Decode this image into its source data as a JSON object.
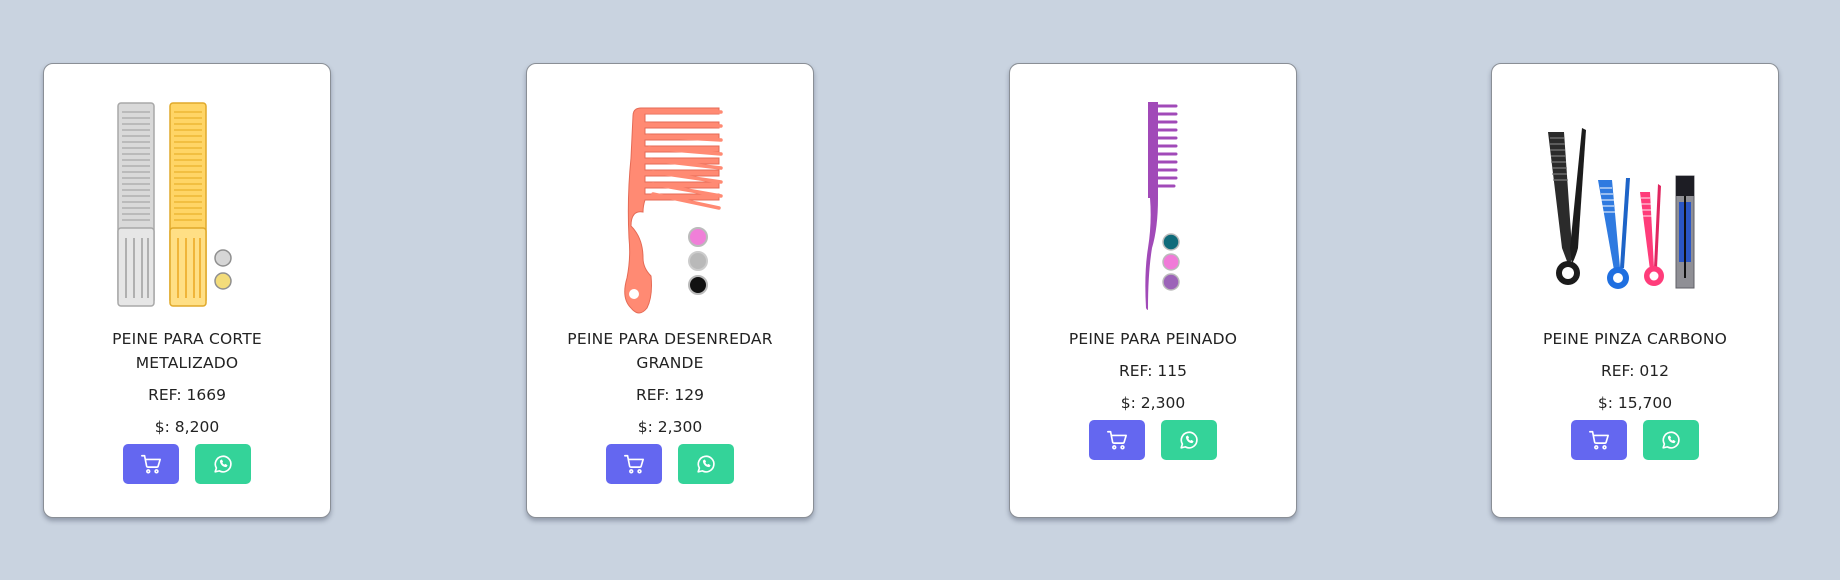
{
  "products": [
    {
      "name": "PEINE PARA CORTE METALIZADO",
      "ref": "REF: 1669",
      "price": "$: 8,200",
      "image": "comb-silver-gold"
    },
    {
      "name": "PEINE PARA DESENREDAR GRANDE",
      "ref": "REF: 129",
      "price": "$: 2,300",
      "image": "detangle-comb-coral"
    },
    {
      "name": "PEINE PARA PEINADO",
      "ref": "REF: 115",
      "price": "$: 2,300",
      "image": "tail-comb-purple"
    },
    {
      "name": "PEINE PINZA CARBONO",
      "ref": "REF: 012",
      "price": "$: 15,700",
      "image": "clip-comb-carbon"
    }
  ],
  "icons": {
    "cart": "shopping-cart-icon",
    "whatsapp": "whatsapp-icon"
  },
  "colors": {
    "background": "#c9d3e0",
    "cart_button": "#6467f0",
    "whatsapp_button": "#34d399"
  }
}
